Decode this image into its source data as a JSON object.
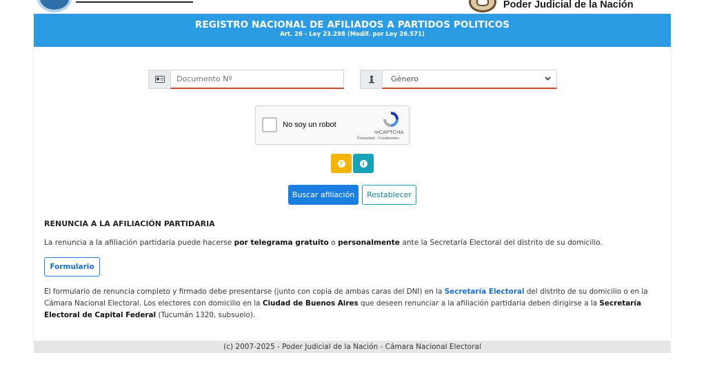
{
  "brand": {
    "right_name": "Poder Judicial de la Nación"
  },
  "header": {
    "title": "REGISTRO NACIONAL DE AFILIADOS A PARTIDOS POLITICOS",
    "subtitle": "Art. 26 - Ley 23.298 (Modif. por Ley 26.571)"
  },
  "form": {
    "document_placeholder": "Documento Nº",
    "gender_selected": "Género",
    "captcha": {
      "label": "No soy un robot",
      "brand": "reCAPTCHA",
      "links": "Privacidad - Condiciones"
    },
    "help_glyph": "?",
    "info_glyph": "i",
    "search_label": "Buscar afiliación",
    "reset_label": "Restablecer"
  },
  "renuncia": {
    "title": "RENUNCIA A LA AFILIACIÓN PARTIDARIA",
    "p1_a": "La renuncia a la afiliación partidaria puede hacerse ",
    "p1_b": "por telegrama gratuito",
    "p1_c": " o ",
    "p1_d": "personalmente",
    "p1_e": " ante la Secretaría Electoral del distrito de su domicilio.",
    "form_button": "Formulario",
    "p2_a": "El formulario de renuncia completo y firmado debe presentarse (junto con copia de ambas caras del DNI) en la ",
    "p2_link": "Secretaría Electoral",
    "p2_b": " del distrito de su domicilio o en la Cámara Nacional Electoral. Los electores con domicilio en la ",
    "p2_c": "Ciudad de Buenos Aires",
    "p2_d": " que deseen renunciar a la afiliación partidaria deben dirigirse a la ",
    "p2_e": "Secretaría Electoral de Capital Federal",
    "p2_f": " (Tucumán 1320, subsuelo)."
  },
  "footer": {
    "text": "(c) 2007-2025 - Poder Judicial de la Nación - Cámara Nacional Electoral"
  },
  "colors": {
    "header_blue": "#2b9be4",
    "primary": "#1a7fe0",
    "help_yellow": "#f4b400",
    "info_teal": "#17a2b8",
    "input_underline": "#c9482f"
  }
}
